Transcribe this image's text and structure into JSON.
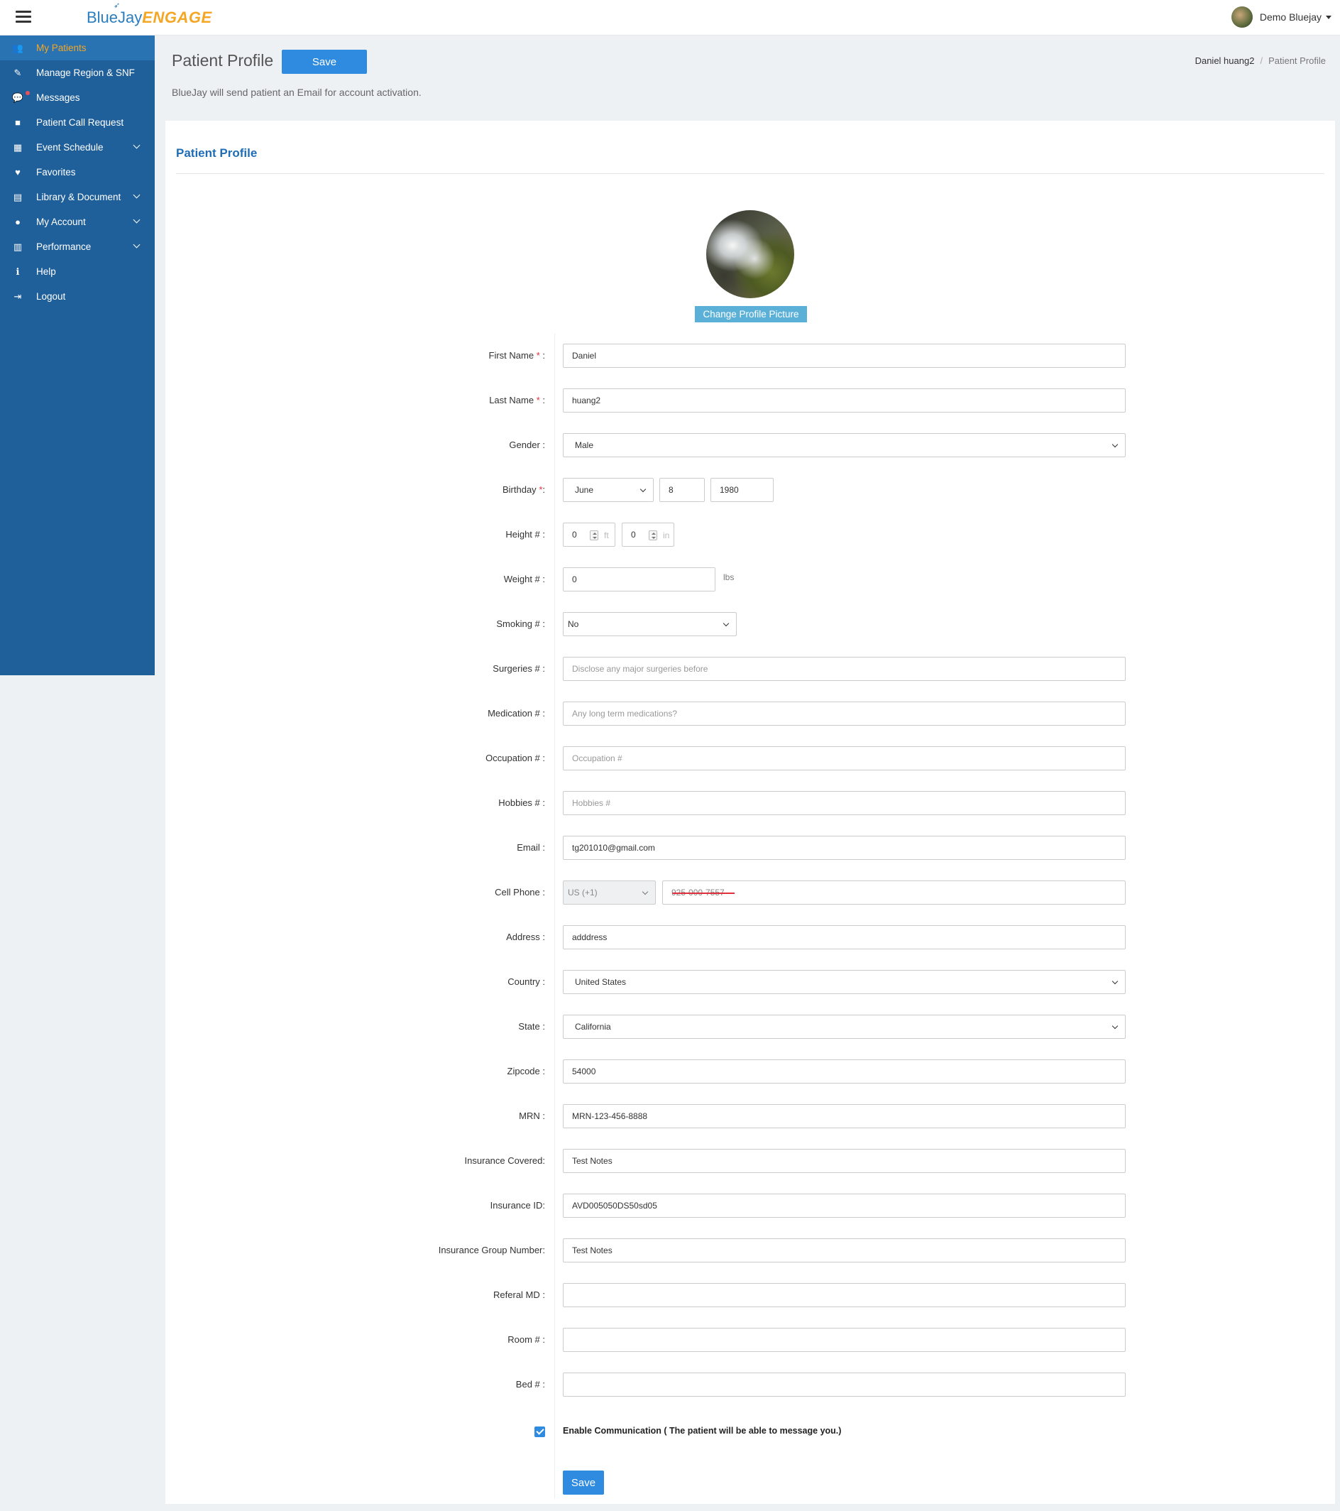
{
  "app": {
    "logo_blue": "BlueJay",
    "logo_orange": "ENGAGE",
    "user_name": "Demo Bluejay"
  },
  "sidebar": {
    "items": [
      {
        "label": "My Patients",
        "icon": "users-icon",
        "glyph": "👥",
        "active": true,
        "expandable": false
      },
      {
        "label": "Manage Region & SNF",
        "icon": "edit-icon",
        "glyph": "✎",
        "active": false,
        "expandable": false
      },
      {
        "label": "Messages",
        "icon": "chat-icon",
        "glyph": "💬",
        "active": false,
        "expandable": false
      },
      {
        "label": "Patient Call Request",
        "icon": "video-icon",
        "glyph": "■",
        "active": false,
        "expandable": false
      },
      {
        "label": "Event Schedule",
        "icon": "calendar-icon",
        "glyph": "▦",
        "active": false,
        "expandable": true
      },
      {
        "label": "Favorites",
        "icon": "heart-icon",
        "glyph": "♥",
        "active": false,
        "expandable": false
      },
      {
        "label": "Library & Document",
        "icon": "books-icon",
        "glyph": "▤",
        "active": false,
        "expandable": true
      },
      {
        "label": "My Account",
        "icon": "user-circle-icon",
        "glyph": "●",
        "active": false,
        "expandable": true
      },
      {
        "label": "Performance",
        "icon": "chart-icon",
        "glyph": "▥",
        "active": false,
        "expandable": true
      },
      {
        "label": "Help",
        "icon": "info-icon",
        "glyph": "ℹ",
        "active": false,
        "expandable": false
      },
      {
        "label": "Logout",
        "icon": "logout-icon",
        "glyph": "⇥",
        "active": false,
        "expandable": false
      }
    ]
  },
  "header": {
    "title": "Patient Profile",
    "save_label": "Save",
    "subtitle": "BlueJay will send patient an Email for account activation.",
    "breadcrumb": [
      "Daniel huang2",
      "Patient Profile"
    ]
  },
  "card": {
    "title": "Patient Profile",
    "change_picture_label": "Change Profile Picture"
  },
  "form": {
    "first_name": {
      "label": "First Name",
      "value": "Daniel"
    },
    "last_name": {
      "label": "Last Name",
      "value": "huang2"
    },
    "gender": {
      "label": "Gender :",
      "value": "Male"
    },
    "birthday": {
      "label": "Birthday",
      "month": "June",
      "day": "8",
      "year": "1980"
    },
    "height": {
      "label": "Height # :",
      "ft": "0",
      "ft_unit": "ft",
      "in": "0",
      "in_unit": "in"
    },
    "weight": {
      "label": "Weight # :",
      "value": "0",
      "unit": "lbs"
    },
    "smoking": {
      "label": "Smoking # :",
      "value": "No"
    },
    "surgeries": {
      "label": "Surgeries # :",
      "placeholder": "Disclose any major surgeries before"
    },
    "medication": {
      "label": "Medication # :",
      "placeholder": "Any long term medications?"
    },
    "occupation": {
      "label": "Occupation # :",
      "placeholder": "Occupation #"
    },
    "hobbies": {
      "label": "Hobbies # :",
      "placeholder": "Hobbies #"
    },
    "email": {
      "label": "Email :",
      "value": "tg201010@gmail.com"
    },
    "cell_phone": {
      "label": "Cell Phone :",
      "country_code": "US (+1)",
      "number": "925-000-7557"
    },
    "address": {
      "label": "Address :",
      "value": "adddress"
    },
    "country": {
      "label": "Country :",
      "value": "United States"
    },
    "state": {
      "label": "State :",
      "value": "California"
    },
    "zipcode": {
      "label": "Zipcode :",
      "value": "54000"
    },
    "mrn": {
      "label": "MRN :",
      "value": "MRN-123-456-8888"
    },
    "insurance_covered": {
      "label": "Insurance Covered:",
      "value": "Test Notes"
    },
    "insurance_id": {
      "label": "Insurance ID:",
      "value": "AVD005050DS50sd05"
    },
    "insurance_group": {
      "label": "Insurance Group Number:",
      "value": "Test Notes"
    },
    "referal_md": {
      "label": "Referal MD :",
      "value": ""
    },
    "room": {
      "label": "Room # :",
      "value": ""
    },
    "bed": {
      "label": "Bed # :",
      "value": ""
    },
    "enable_communication": {
      "label": "Enable Communication ( The patient will be able to message you.)",
      "checked": true
    },
    "save_label": "Save"
  }
}
